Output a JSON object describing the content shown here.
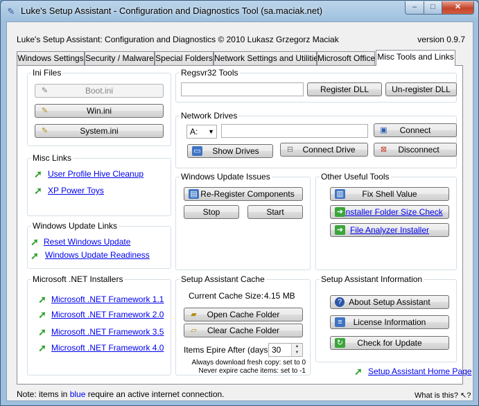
{
  "window": {
    "title": "Luke's Setup Assistant - Configuration and Diagnostics Tool (sa.maciak.net)",
    "controls": {
      "minimize": "–",
      "maximize": "□",
      "close": "✕"
    }
  },
  "header": {
    "left": "Luke's Setup Assistant: Configuration and Diagnostics © 2010 Lukasz Grzegorz Maciak",
    "version": "version 0.9.7"
  },
  "tabs": [
    {
      "label": "Windows Settings"
    },
    {
      "label": "Security / Malware"
    },
    {
      "label": "Special Folders"
    },
    {
      "label": "Network Settings and Utilities"
    },
    {
      "label": "Microsoft Office"
    },
    {
      "label": "Misc Tools and Links"
    }
  ],
  "ini_files": {
    "title": "Ini Files",
    "boot_ini": "Boot.ini",
    "win_ini": "Win.ini",
    "system_ini": "System.ini"
  },
  "misc_links": {
    "title": "Misc Links",
    "items": [
      "User Profile Hive Cleanup",
      "XP Power Toys"
    ]
  },
  "windows_update_links": {
    "title": "Windows Update Links",
    "items": [
      "Reset Windows Update",
      "Windows Update Readiness"
    ]
  },
  "net_installers": {
    "title": "Microsoft .NET Installers",
    "items": [
      "Microsoft .NET Framework 1.1",
      "Microsoft .NET Framework 2.0",
      "Microsoft .NET Framework 3.5",
      "Microsoft .NET Framework 4.0"
    ]
  },
  "regsvr32": {
    "title": "Regsvr32 Tools",
    "input_value": "",
    "register": "Register DLL",
    "unregister": "Un-register DLL"
  },
  "network_drives": {
    "title": "Network Drives",
    "drive_letter": "A:",
    "path_value": "",
    "connect": "Connect",
    "show_drives": "Show Drives",
    "connect_drive": "Connect Drive",
    "disconnect": "Disconnect"
  },
  "windows_update_issues": {
    "title": "Windows Update Issues",
    "reregister": "Re-Register Components",
    "stop": "Stop",
    "start": "Start"
  },
  "other_tools": {
    "title": "Other Useful Tools",
    "fix_shell": "Fix Shell Value",
    "installer_folder": "Installer Folder Size Check",
    "file_analyzer": "File Analyzer Installer"
  },
  "cache": {
    "title": "Setup Assistant Cache",
    "current_size_label": "Current Cache Size:",
    "current_size_value": "4.15 MB",
    "open_folder": "Open Cache Folder",
    "clear_folder": "Clear Cache Folder",
    "expire_label": "Items Epire After (days):",
    "expire_value": "30",
    "note1": "Always download fresh copy: set to 0",
    "note2": "Never expire cache items: set to -1"
  },
  "info": {
    "title": "Setup Assistant Information",
    "about": "About Setup Assistant",
    "license": "License Information",
    "check_update": "Check for Update",
    "home_page": "Setup Assistant Home Page"
  },
  "status": {
    "prefix": "Note: items in ",
    "blue_word": "blue",
    "suffix": " require an active internet connection.",
    "whatis": "What is this?"
  }
}
